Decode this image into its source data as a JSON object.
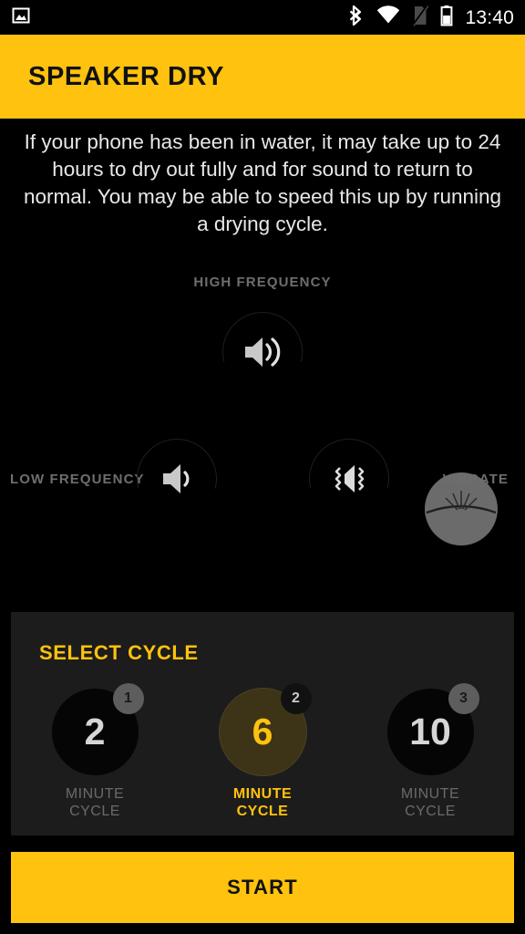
{
  "statusbar": {
    "time": "13:40",
    "icons": [
      {
        "name": "image-icon",
        "side": "left"
      },
      {
        "name": "bluetooth-icon",
        "side": "right"
      },
      {
        "name": "wifi-icon",
        "side": "right"
      },
      {
        "name": "no-sim-icon",
        "side": "right"
      },
      {
        "name": "battery-icon",
        "side": "right"
      }
    ]
  },
  "header": {
    "title": "SPEAKER DRY",
    "background": "#FFC20E",
    "text_color": "#111111"
  },
  "intro": {
    "text": "If your phone has been in water, it may take up to 24 hours to dry out fully and for sound to return to normal. You may be able to speed this up by running a drying cycle."
  },
  "diagram": {
    "high_label": "HIGH FREQUENCY",
    "low_label": "LOW FREQUENCY",
    "vibrate_label": "VIBRATE",
    "high_icon": "speaker-high-volume-icon",
    "low_icon": "speaker-low-volume-icon",
    "vibrate_icon": "vibrate-icon",
    "arrow_icon": "chevron-arrows-icon",
    "decoration_icon": "water-splash-icon",
    "label_color": "#6e6e6e"
  },
  "select_cycle": {
    "title": "SELECT CYCLE",
    "title_color": "#FFC20E",
    "cycles": [
      {
        "badge": "1",
        "number": "2",
        "label_line1": "MINUTE",
        "label_line2": "CYCLE",
        "selected": false
      },
      {
        "badge": "2",
        "number": "6",
        "label_line1": "MINUTE",
        "label_line2": "CYCLE",
        "selected": true
      },
      {
        "badge": "3",
        "number": "10",
        "label_line1": "MINUTE",
        "label_line2": "CYCLE",
        "selected": false
      }
    ]
  },
  "start": {
    "label": "START",
    "background": "#FFC20E",
    "text_color": "#111111"
  }
}
